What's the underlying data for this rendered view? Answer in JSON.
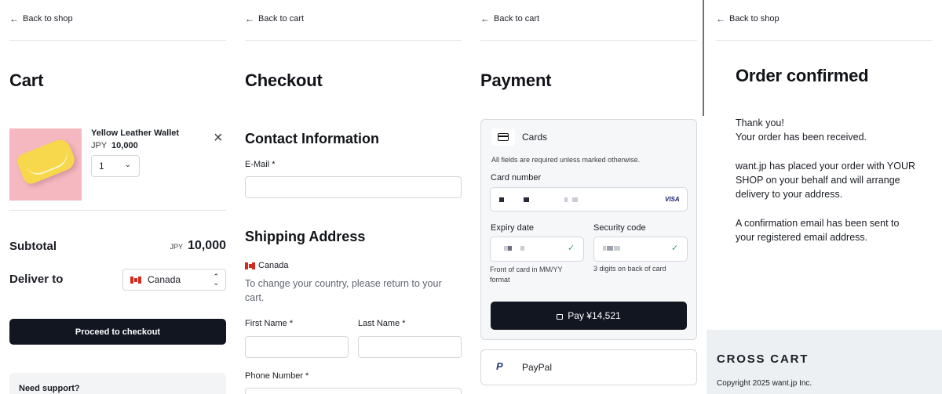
{
  "cart": {
    "back": "Back to shop",
    "title": "Cart",
    "item_name": "Yellow Leather Wallet",
    "item_currency": "JPY",
    "item_price": "10,000",
    "qty": "1",
    "subtotal_label": "Subtotal",
    "subtotal_currency": "JPY",
    "subtotal_value": "10,000",
    "deliver_label": "Deliver to",
    "deliver_country": "Canada",
    "checkout_button": "Proceed to checkout",
    "support": "Need support?"
  },
  "checkout": {
    "back": "Back to cart",
    "title": "Checkout",
    "contact_heading": "Contact Information",
    "email_label": "E-Mail *",
    "shipping_heading": "Shipping Address",
    "country": "Canada",
    "country_note": "To change your country, please return to your cart.",
    "first_name_label": "First Name *",
    "last_name_label": "Last Name *",
    "phone_label": "Phone Number *"
  },
  "payment": {
    "back": "Back to cart",
    "title": "Payment",
    "cards_label": "Cards",
    "required_note": "All fields are required unless marked otherwise.",
    "card_number_label": "Card number",
    "card_brand": "VISA",
    "expiry_label": "Expiry date",
    "expiry_help": "Front of card in MM/YY format",
    "security_label": "Security code",
    "security_help": "3 digits on back of card",
    "pay_button": "Pay ¥14,521",
    "paypal_label": "PayPal"
  },
  "confirmation": {
    "back": "Back to shop",
    "title": "Order confirmed",
    "thanks": "Thank you!",
    "received": "Your order has been received.",
    "placed": "want.jp has placed your order with YOUR SHOP on your behalf and will arrange delivery to your address.",
    "email_note": "A confirmation email has been sent to your registered email address.",
    "footer_brand": "CROSS CART",
    "copyright": "Copyright 2025 want.jp Inc."
  },
  "colors": {
    "primary": "#121621",
    "success": "#3aa757",
    "thumb_bg": "#f5b8c1",
    "wallet": "#f7d84d"
  }
}
